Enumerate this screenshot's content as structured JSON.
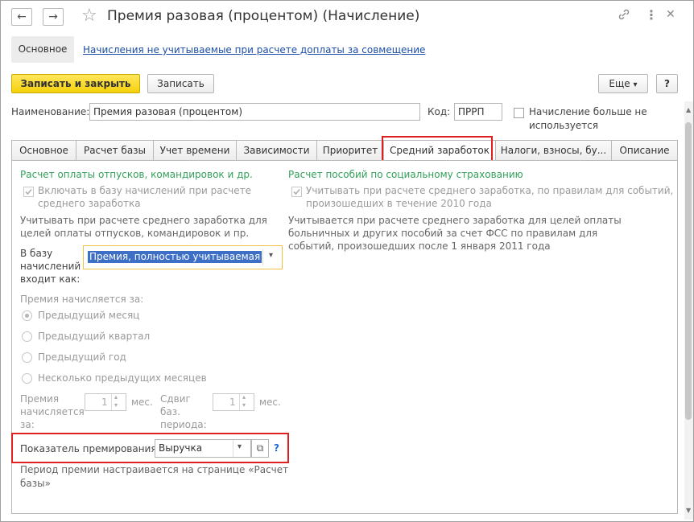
{
  "window": {
    "title": "Премия разовая (процентом) (Начисление)",
    "back_icon": "←",
    "forward_icon": "→",
    "star_icon": "☆",
    "link_icon": "🔗",
    "menu_icon": "⋮",
    "close_icon": "✕"
  },
  "subnav": {
    "main": "Основное",
    "link": "Начисления не учитываемые при расчете доплаты за совмещение"
  },
  "toolbar": {
    "save_close": "Записать и закрыть",
    "save": "Записать",
    "more": "Еще",
    "more_arrow": "▾",
    "help": "?"
  },
  "header": {
    "name_label": "Наименование:",
    "name_value": "Премия разовая (процентом)",
    "code_label": "Код:",
    "code_value": "ПРРП",
    "unused_label_1": "Начисление больше не",
    "unused_label_2": "используется"
  },
  "tabs": [
    {
      "label": "Основное"
    },
    {
      "label": "Расчет базы"
    },
    {
      "label": "Учет времени"
    },
    {
      "label": "Зависимости"
    },
    {
      "label": "Приоритет"
    },
    {
      "label": "Средний заработок"
    },
    {
      "label": "Налоги, взносы, бу..."
    },
    {
      "label": "Описание"
    }
  ],
  "left": {
    "section_title": "Расчет оплаты отпусков, командировок и др.",
    "include_check_1": "Включать в базу начислений при расчете",
    "include_check_2": "среднего заработка",
    "note_1": "Учитывать при расчете среднего заработка для",
    "note_2": "целей оплаты отпусков, командировок и пр.",
    "base_label_1": "В базу",
    "base_label_2": "начислений",
    "base_label_3": "входит как:",
    "base_value": "Премия, полностью учитываемая",
    "dropdown_arrow": "▾",
    "accrued_for": "Премия начисляется за:",
    "radios": [
      {
        "label": "Предыдущий месяц",
        "checked": true
      },
      {
        "label": "Предыдущий квартал",
        "checked": false
      },
      {
        "label": "Предыдущий год",
        "checked": false
      },
      {
        "label": "Несколько предыдущих месяцев",
        "checked": false
      }
    ],
    "period_label_1": "Премия",
    "period_label_2": "начисляется",
    "period_label_3": "за:",
    "period_value": "1",
    "period_unit": "мес.",
    "shift_label_1": "Сдвиг",
    "shift_label_2": "баз.",
    "shift_label_3": "периода:",
    "shift_value": "1",
    "shift_unit": "мес.",
    "indicator_label": "Показатель премирования:",
    "indicator_value": "Выручка",
    "indicator_open_icon": "⧉",
    "indicator_help": "?",
    "footer_note_1": "Период премии настраивается на странице «Расчет",
    "footer_note_2": "базы»"
  },
  "right": {
    "section_title": "Расчет пособий по социальному страхованию",
    "check_1": "Учитывать при расчете среднего заработка, по правилам для событий,",
    "check_2": "произошедших в течение 2010 года",
    "note_1": "Учитывается при расчете среднего заработка для целей оплаты",
    "note_2": "больничных и других пособий за счет ФСС по правилам для",
    "note_3": "событий, произошедших после 1 января 2011 года"
  }
}
